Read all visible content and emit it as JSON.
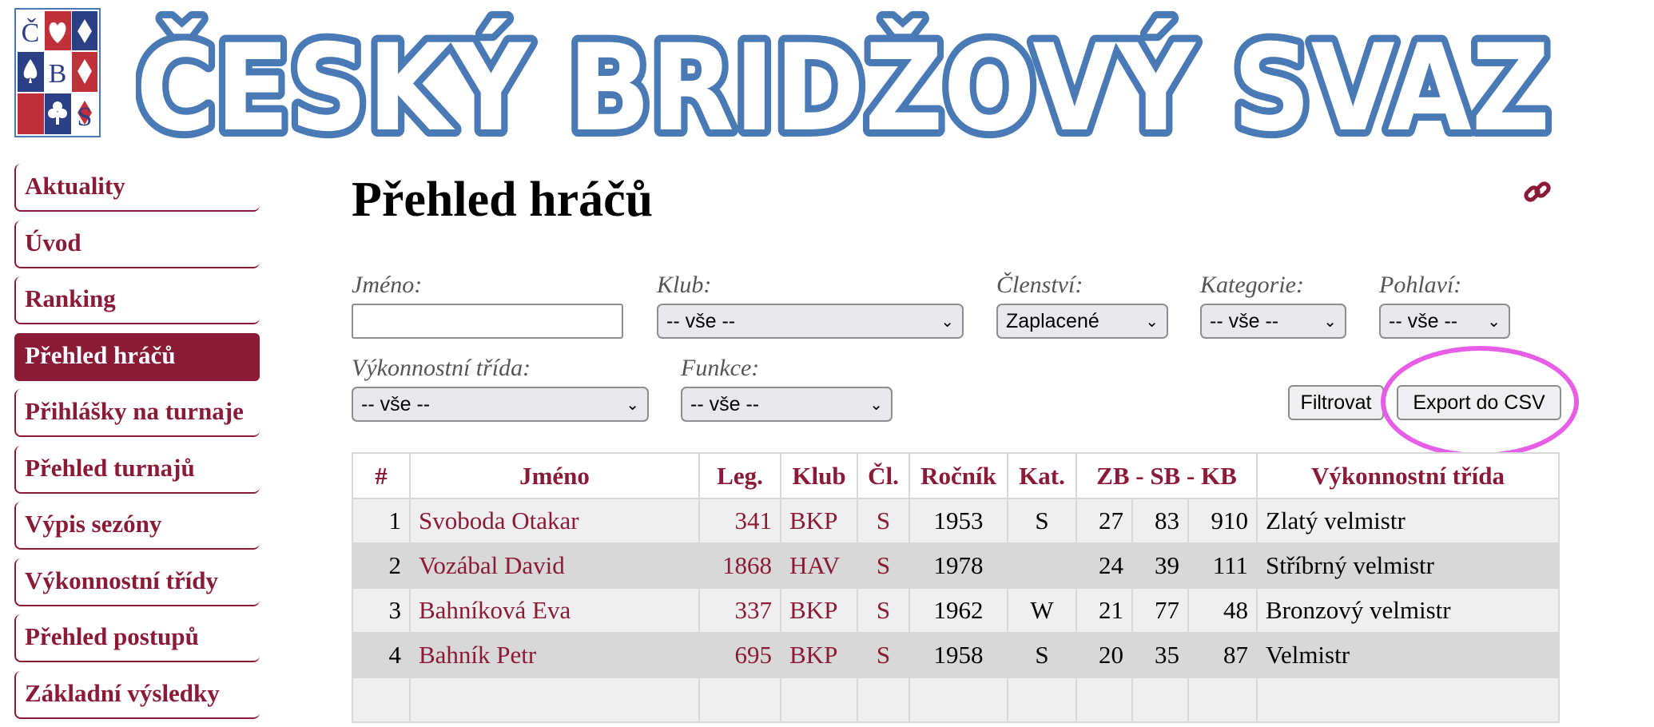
{
  "logo": {
    "letters": [
      "Č",
      "B",
      "S"
    ],
    "suits": [
      "heart-icon",
      "spade-icon",
      "diamond-icon",
      "club-icon"
    ]
  },
  "banner": {
    "text": "ČESKÝ BRIDŽOVÝ SVAZ"
  },
  "colors": {
    "brand": "#8a1a36",
    "banner": "#4a7ab5",
    "highlight": "#e65ee6"
  },
  "sidebar": {
    "items": [
      {
        "label": "Aktuality",
        "active": false
      },
      {
        "label": "Úvod",
        "active": false
      },
      {
        "label": "Ranking",
        "active": false
      },
      {
        "label": "Přehled hráčů",
        "active": true
      },
      {
        "label": "Přihlášky na turnaje",
        "active": false
      },
      {
        "label": "Přehled turnajů",
        "active": false
      },
      {
        "label": "Výpis sezóny",
        "active": false
      },
      {
        "label": "Výkonnostní třídy",
        "active": false
      },
      {
        "label": "Přehled postupů",
        "active": false
      },
      {
        "label": "Základní výsledky",
        "active": false
      }
    ]
  },
  "main": {
    "title": "Přehled hráčů",
    "link_icon": "link-icon"
  },
  "filters": {
    "jmeno": {
      "label": "Jméno:",
      "value": ""
    },
    "klub": {
      "label": "Klub:",
      "value": "-- vše --"
    },
    "clenstvi": {
      "label": "Členství:",
      "value": "Zaplacené"
    },
    "kategorie": {
      "label": "Kategorie:",
      "value": "-- vše --"
    },
    "pohlavi": {
      "label": "Pohlaví:",
      "value": "-- vše --"
    },
    "vykonnostni": {
      "label": "Výkonnostní třída:",
      "value": "-- vše --"
    },
    "funkce": {
      "label": "Funkce:",
      "value": "-- vše --"
    },
    "filter_button": "Filtrovat",
    "export_button": "Export do CSV"
  },
  "table": {
    "headers": [
      "#",
      "Jméno",
      "Leg.",
      "Klub",
      "Čl.",
      "Ročník",
      "Kat.",
      "ZB - SB - KB",
      "Výkonnostní třída"
    ],
    "rows": [
      {
        "n": "1",
        "jmeno": "Svoboda Otakar",
        "leg": "341",
        "klub": "BKP",
        "cl": "S",
        "rocnik": "1953",
        "kat": "S",
        "zb": "27",
        "sb": "83",
        "kb": "910",
        "trida": "Zlatý velmistr"
      },
      {
        "n": "2",
        "jmeno": "Vozábal David",
        "leg": "1868",
        "klub": "HAV",
        "cl": "S",
        "rocnik": "1978",
        "kat": "",
        "zb": "24",
        "sb": "39",
        "kb": "111",
        "trida": "Stříbrný velmistr"
      },
      {
        "n": "3",
        "jmeno": "Bahníková Eva",
        "leg": "337",
        "klub": "BKP",
        "cl": "S",
        "rocnik": "1962",
        "kat": "W",
        "zb": "21",
        "sb": "77",
        "kb": "48",
        "trida": "Bronzový velmistr"
      },
      {
        "n": "4",
        "jmeno": "Bahník Petr",
        "leg": "695",
        "klub": "BKP",
        "cl": "S",
        "rocnik": "1958",
        "kat": "S",
        "zb": "20",
        "sb": "35",
        "kb": "87",
        "trida": "Velmistr"
      }
    ]
  }
}
